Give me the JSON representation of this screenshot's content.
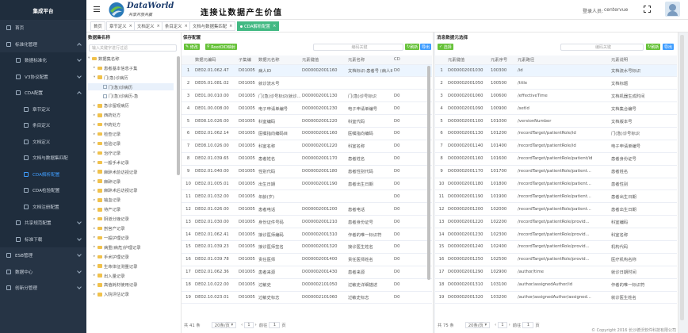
{
  "app": {
    "title": "集成平台",
    "logo_main": "DataWorld",
    "logo_sub": "共享开放共赢",
    "slogan": "连接让数据产生价值",
    "login_label": "登录人员:",
    "user": "centervue"
  },
  "sidebar": {
    "items": [
      {
        "label": "首页",
        "level": 0
      },
      {
        "label": "标准化管理",
        "level": 0,
        "open": true
      },
      {
        "label": "数据标准化",
        "level": 1
      },
      {
        "label": "V3协议配置",
        "level": 1
      },
      {
        "label": "CDA配置",
        "level": 1,
        "open": true
      },
      {
        "label": "章节定义",
        "level": 2
      },
      {
        "label": "条目定义",
        "level": 2
      },
      {
        "label": "文档定义",
        "level": 2
      },
      {
        "label": "文档与数据集匹配",
        "level": 2
      },
      {
        "label": "CDA解析配置",
        "level": 2,
        "active": true
      },
      {
        "label": "CDA检验配置",
        "level": 2
      },
      {
        "label": "文档注册配置",
        "level": 2
      },
      {
        "label": "共享规范配置",
        "level": 1
      },
      {
        "label": "标准下载",
        "level": 1
      },
      {
        "label": "ESB管理",
        "level": 0
      },
      {
        "label": "数据中心",
        "level": 0
      },
      {
        "label": "创新分管理",
        "level": 0
      }
    ]
  },
  "tabs": [
    {
      "label": "首页"
    },
    {
      "label": "章节定义",
      "close": "×"
    },
    {
      "label": "文档定义",
      "close": "×"
    },
    {
      "label": "条目定义",
      "close": "×"
    },
    {
      "label": "文档与数据集匹配",
      "close": "×"
    },
    {
      "label": "CDA解析配置",
      "close": "×",
      "active": true
    }
  ],
  "left_panel": {
    "title": "数据集名称",
    "search_placeholder": "输入关键字进行过滤",
    "tree": [
      {
        "label": "数据集名称",
        "indent": 0,
        "type": "folder",
        "caret": "▾"
      },
      {
        "label": "患者基本信息子集",
        "indent": 1,
        "type": "folder",
        "caret": "▸"
      },
      {
        "label": "门(急)诊病历",
        "indent": 1,
        "type": "folder",
        "caret": "▾"
      },
      {
        "label": "门(急)诊病历",
        "indent": 2,
        "type": "file",
        "caret": ""
      },
      {
        "label": "门(急)诊病历-急",
        "indent": 2,
        "type": "file",
        "caret": ""
      },
      {
        "label": "急诊留观病历",
        "indent": 1,
        "type": "folder",
        "caret": "▸"
      },
      {
        "label": "西药处方",
        "indent": 1,
        "type": "folder",
        "caret": "▸"
      },
      {
        "label": "中药处方",
        "indent": 1,
        "type": "folder",
        "caret": "▸"
      },
      {
        "label": "检查记录",
        "indent": 1,
        "type": "folder",
        "caret": "▸"
      },
      {
        "label": "检验记录",
        "indent": 1,
        "type": "folder",
        "caret": "▸"
      },
      {
        "label": "治疗记录",
        "indent": 1,
        "type": "folder",
        "caret": "▸"
      },
      {
        "label": "一般手术记录",
        "indent": 1,
        "type": "folder",
        "caret": "▸"
      },
      {
        "label": "麻醉术前访视记录",
        "indent": 1,
        "type": "folder",
        "caret": "▸"
      },
      {
        "label": "麻醉记录",
        "indent": 1,
        "type": "folder",
        "caret": "▸"
      },
      {
        "label": "麻醉术后访视记录",
        "indent": 1,
        "type": "folder",
        "caret": "▸"
      },
      {
        "label": "输血记录",
        "indent": 1,
        "type": "folder",
        "caret": "▸"
      },
      {
        "label": "待产记录",
        "indent": 1,
        "type": "folder",
        "caret": "▸"
      },
      {
        "label": "阴道分娩记录",
        "indent": 1,
        "type": "folder",
        "caret": "▸"
      },
      {
        "label": "剖宫产记录",
        "indent": 1,
        "type": "folder",
        "caret": "▸"
      },
      {
        "label": "一般护理记录",
        "indent": 1,
        "type": "folder",
        "caret": "▸"
      },
      {
        "label": "病重(病危)护理记录",
        "indent": 1,
        "type": "folder",
        "caret": "▸"
      },
      {
        "label": "手术护理记录",
        "indent": 1,
        "type": "folder",
        "caret": "▸"
      },
      {
        "label": "生命体征测量记录",
        "indent": 1,
        "type": "folder",
        "caret": "▸"
      },
      {
        "label": "出入量记录",
        "indent": 1,
        "type": "folder",
        "caret": "▸"
      },
      {
        "label": "高值耗材使用记录",
        "indent": 1,
        "type": "folder",
        "caret": "▸"
      },
      {
        "label": "入院评估记录",
        "indent": 1,
        "type": "folder",
        "caret": "▸"
      }
    ]
  },
  "mid_panel": {
    "title": "保存配置",
    "btn_edit": "修改",
    "btn_root": "RootOID映射",
    "search_placeholder": "编码关键",
    "btn_refresh": "刷新",
    "btn_export": "导出",
    "columns": [
      "",
      "数据元编码",
      "子集编",
      "数据元名称",
      "元素键值",
      "元素名称",
      "CD"
    ],
    "rows": [
      [
        "1",
        "DE02.01.062.47",
        "D01005",
        "病人ID",
        "D000002001160",
        "文档标识-患者号 (病人ID)",
        "D0"
      ],
      [
        "2",
        "DE05.01.081.02",
        "D01005",
        "就诊流水号",
        "",
        "",
        ""
      ],
      [
        "3",
        "DE01.00.010.00",
        "D01005",
        "门(急)诊号标识(就诊...",
        "D000002001130",
        "门(急)诊号标识",
        "D0"
      ],
      [
        "4",
        "DE01.00.008.00",
        "D01005",
        "电子申请单编号",
        "D000002001230",
        "电子申请单编号",
        "D0"
      ],
      [
        "5",
        "DE08.10.026.00",
        "D01005",
        "科室编码",
        "D000002001220",
        "科室代码",
        "D0"
      ],
      [
        "6",
        "DE02.01.062.14",
        "D01005",
        "医嘱指向编码目",
        "D000002001160",
        "医嘱指向编码",
        "D0"
      ],
      [
        "7",
        "DE08.10.026.00",
        "D01005",
        "科室名称",
        "D000002001220",
        "科室名称",
        "D0"
      ],
      [
        "8",
        "DE02.01.039.65",
        "D01005",
        "患者姓名",
        "D000002001170",
        "患者姓名",
        "D0"
      ],
      [
        "9",
        "DE02.01.040.00",
        "D01005",
        "性别代码",
        "D000002001180",
        "患者性别代码",
        "D0"
      ],
      [
        "10",
        "DE02.01.005.01",
        "D01005",
        "出生日期",
        "D000002001190",
        "患者出生日期",
        "D0"
      ],
      [
        "11",
        "DE02.01.032.00",
        "D01005",
        "年龄(岁)",
        "",
        "",
        "D0"
      ],
      [
        "12",
        "DE02.01.026.00",
        "D01005",
        "患者电话",
        "D000002001200",
        "患者电话",
        "D0"
      ],
      [
        "13",
        "DE02.01.030.00",
        "D01005",
        "身份证件号码",
        "D000002001210",
        "患者身份证号",
        "D0"
      ],
      [
        "14",
        "DE02.01.062.41",
        "D01005",
        "接诊医师编码",
        "D000002001310",
        "作者的唯一标识符",
        "D0"
      ],
      [
        "15",
        "DE02.01.039.23",
        "D01005",
        "接诊医师签名",
        "D000002001320",
        "接诊医生姓名",
        "D0"
      ],
      [
        "16",
        "DE02.01.039.78",
        "D01005",
        "责任医师",
        "D000002001400",
        "责任医师姓名",
        "D0"
      ],
      [
        "17",
        "DE02.01.062.36",
        "D01005",
        "患者来源",
        "D000002001430",
        "患者来源",
        "D0"
      ],
      [
        "18",
        "DE02.10.022.00",
        "D01005",
        "过敏史",
        "D000002101050",
        "过敏史详细描述",
        "D0"
      ],
      [
        "19",
        "DE02.10.023.01",
        "D01005",
        "过敏史标志",
        "D000002101060",
        "过敏史标志",
        "D0"
      ]
    ],
    "total": "共 41 条",
    "page_size": "20条/页",
    "goto": "前往",
    "page": "1",
    "page_unit": "页"
  },
  "right_panel": {
    "title": "消息数据元选择",
    "btn_select": "选择",
    "search_placeholder": "编码关键",
    "btn_refresh": "刷新",
    "btn_export": "导出",
    "columns": [
      "",
      "元素键值",
      "元素序号",
      "元素路径",
      "元素说明"
    ],
    "rows": [
      [
        "1",
        "D000002001030",
        "100300",
        "/id",
        "文档流水号标识"
      ],
      [
        "2",
        "D000002001050",
        "100500",
        "/title",
        "文档标题"
      ],
      [
        "3",
        "D000002001060",
        "100600",
        "/effectiveTime",
        "文档机器生成时间"
      ],
      [
        "4",
        "D000002001090",
        "100900",
        "/setId",
        "文档集合编号"
      ],
      [
        "5",
        "D000002001100",
        "101000",
        "/versionNumber",
        "文档版本号"
      ],
      [
        "6",
        "D000002001130",
        "101200",
        "/recordTarget/patientRole/id",
        "门(急)诊号标识"
      ],
      [
        "7",
        "D000002001140",
        "101400",
        "/recordTarget/patientRole/id",
        "电子申请单编号"
      ],
      [
        "8",
        "D000002001160",
        "101600",
        "/recordTarget/patientRole/patient/id",
        "患者身份证号"
      ],
      [
        "9",
        "D000002001170",
        "101700",
        "/recordTarget/patientRole/patient...",
        "患者姓名"
      ],
      [
        "10",
        "D000002001180",
        "101800",
        "/recordTarget/patientRole/patient...",
        "患者性别"
      ],
      [
        "11",
        "D000002001190",
        "101900",
        "/recordTarget/patientRole/patient...",
        "患者出生日期"
      ],
      [
        "12",
        "D000002001200",
        "102000",
        "/recordTarget/patientRole/patient...",
        "患者出生日期"
      ],
      [
        "13",
        "D000002001220",
        "102200",
        "/recordTarget/patientRole/provid...",
        "科室编码"
      ],
      [
        "14",
        "D000002001230",
        "102300",
        "/recordTarget/patientRole/provid...",
        "科室名称"
      ],
      [
        "15",
        "D000002001240",
        "102400",
        "/recordTarget/patientRole/provid...",
        "机构代码"
      ],
      [
        "16",
        "D000002001250",
        "102500",
        "/recordTarget/patientRole/provid...",
        "医疗机构名称"
      ],
      [
        "17",
        "D000002001290",
        "102900",
        "/author/time",
        "就诊日期时间"
      ],
      [
        "18",
        "D000002001310",
        "103100",
        "/author/assignedAuthor/id",
        "作者的唯一标识符"
      ],
      [
        "19",
        "D000002001320",
        "103200",
        "/author/assignedAuthor/assigned...",
        "就诊医生姓名"
      ]
    ],
    "total": "共 75 条",
    "page_size": "20条/页",
    "goto": "前往",
    "page": "1",
    "page_unit": "页"
  },
  "footer": {
    "copyright": "© Copyright 2016 长沙德沃软件科技有限公司"
  }
}
